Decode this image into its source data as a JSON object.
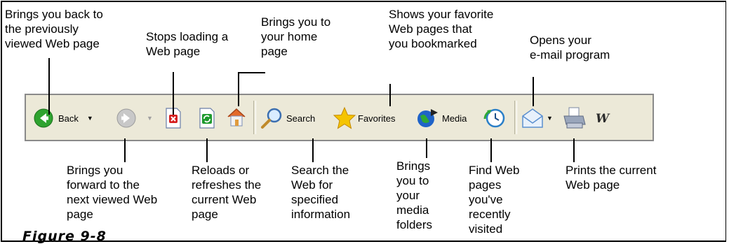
{
  "captions": {
    "back": "Brings you back to\nthe previously\nviewed Web page",
    "stop": "Stops loading a\nWeb page",
    "home": "Brings you to\nyour home\npage",
    "favorites": "Shows your favorite\nWeb pages that\nyou bookmarked",
    "mail": "Opens your\ne-mail program",
    "forward": "Brings you\nforward to the\nnext viewed Web\npage",
    "refresh": "Reloads or\nrefreshes the\ncurrent Web\npage",
    "search": "Search the\nWeb for\nspecified\ninformation",
    "media": "Brings\nyou to\nyour\nmedia\nfolders",
    "history": "Find Web\npages\nyou've\nrecently\nvisited",
    "print": "Prints the current\nWeb page"
  },
  "toolbar": {
    "back_label": "Back",
    "search_label": "Search",
    "favorites_label": "Favorites",
    "media_label": "Media",
    "word_glyph": "W"
  },
  "figure_label": "Figure 9-8",
  "colors": {
    "toolbar_bg": "#ece9d8",
    "back_green": "#2fa32f",
    "stop_red": "#d62020",
    "refresh_green": "#1e9a2e",
    "favorites_star": "#f5c400",
    "media_globe": "#1f63c8"
  }
}
